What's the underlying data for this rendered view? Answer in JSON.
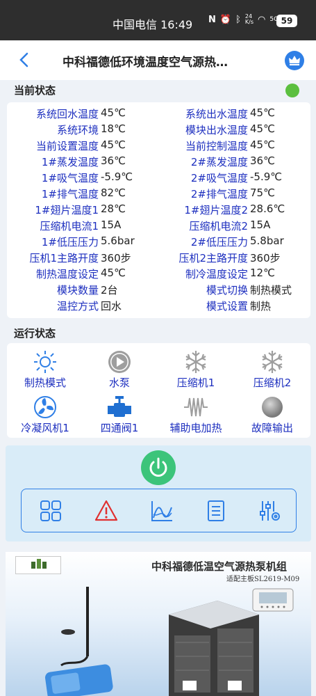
{
  "statusbar": {
    "carrier": "中国电信",
    "time": "16:49",
    "network": "4G",
    "speed": "24\nK/s",
    "signal": "5G",
    "battery": "59"
  },
  "header": {
    "title": "中科福德低环境温度空气源热…"
  },
  "current_status": {
    "title": "当前状态",
    "rows": [
      {
        "l_label": "系统回水温度",
        "l_value": "45℃",
        "r_label": "系统出水温度",
        "r_value": "45℃"
      },
      {
        "l_label": "系统环境",
        "l_value": "18℃",
        "r_label": "模块出水温度",
        "r_value": "45℃"
      },
      {
        "l_label": "当前设置温度",
        "l_value": "45℃",
        "r_label": "当前控制温度",
        "r_value": "45℃"
      },
      {
        "l_label": "1#蒸发温度",
        "l_value": "36℃",
        "r_label": "2#蒸发温度",
        "r_value": "36℃"
      },
      {
        "l_label": "1#吸气温度",
        "l_value": "-5.9℃",
        "r_label": "2#吸气温度",
        "r_value": "-5.9℃"
      },
      {
        "l_label": "1#排气温度",
        "l_value": "82℃",
        "r_label": "2#排气温度",
        "r_value": "75℃"
      },
      {
        "l_label": "1#翅片温度1",
        "l_value": "28℃",
        "r_label": "1#翅片温度2",
        "r_value": "28.6℃"
      },
      {
        "l_label": "压缩机电流1",
        "l_value": "15A",
        "r_label": "压缩机电流2",
        "r_value": "15A"
      },
      {
        "l_label": "1#低压压力",
        "l_value": "5.6bar",
        "r_label": "2#低压压力",
        "r_value": "5.8bar"
      },
      {
        "l_label": "压机1主路开度",
        "l_value": "360步",
        "r_label": "压机2主路开度",
        "r_value": "360步"
      },
      {
        "l_label": "制热温度设定",
        "l_value": "45℃",
        "r_label": "制冷温度设定",
        "r_value": "12℃"
      },
      {
        "l_label": "模块数量",
        "l_value": "2台",
        "r_label": "模式切换",
        "r_value": "制热模式"
      },
      {
        "l_label": "温控方式",
        "l_value": "回水",
        "r_label": "模式设置",
        "r_value": "制热"
      }
    ]
  },
  "run_status": {
    "title": "运行状态",
    "items": [
      "制热模式",
      "水泵",
      "压缩机1",
      "压缩机2",
      "冷凝风机1",
      "四通阀1",
      "辅助电加热",
      "故障输出"
    ]
  },
  "banner": {
    "title": "中科福德低温空气源热泵机组",
    "subtitle": "适配主板SL2619-M09"
  },
  "colors": {
    "accent": "#2f7fe6",
    "label": "#1d2fbf",
    "status_ok": "#5bbf3f",
    "power": "#3cc47a",
    "alert": "#e03030"
  }
}
